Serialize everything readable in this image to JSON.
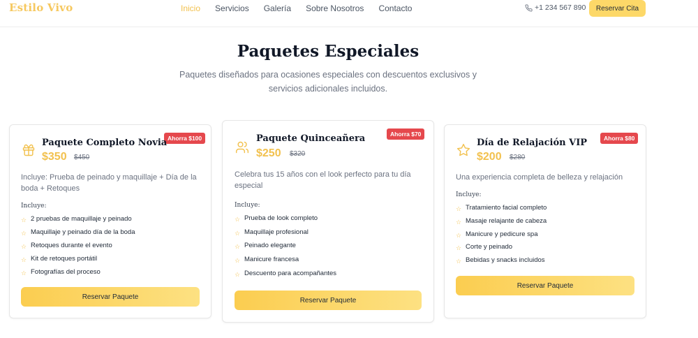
{
  "brand": {
    "logo": "Estilo Vivo",
    "accent_color": "#f2c14e"
  },
  "nav": {
    "links": [
      "Inicio",
      "Servicios",
      "Galería",
      "Sobre Nosotros",
      "Contacto"
    ],
    "active": "Inicio",
    "phone_icon": "phone-icon",
    "phone": "+1 234 567 890",
    "cta": "Reservar Cita"
  },
  "section": {
    "title": "Paquetes Especiales",
    "subtitle": "Paquetes diseñados para ocasiones especiales con descuentos exclusivos y servicios adicionales incluidos."
  },
  "packages": [
    {
      "icon": "gift-icon",
      "badge": "Ahorra $100",
      "title": "Paquete Completo Novia",
      "price": "$350",
      "old_price": "$450",
      "description": "Incluye: Prueba de peinado y maquillaje + Día de la boda + Retoques",
      "includes_label": "Incluye:",
      "features": [
        "2 pruebas de maquillaje y peinado",
        "Maquillaje y peinado día de la boda",
        "Retoques durante el evento",
        "Kit de retoques portátil",
        "Fotografías del proceso"
      ],
      "button": "Reservar Paquete"
    },
    {
      "icon": "users-icon",
      "badge": "Ahorra $70",
      "title": "Paquete Quinceañera",
      "price": "$250",
      "old_price": "$320",
      "description": "Celebra tus 15 años con el look perfecto para tu día especial",
      "includes_label": "Incluye:",
      "features": [
        "Prueba de look completo",
        "Maquillaje profesional",
        "Peinado elegante",
        "Manicure francesa",
        "Descuento para acompañantes"
      ],
      "button": "Reservar Paquete"
    },
    {
      "icon": "star-outline-icon",
      "badge": "Ahorra $80",
      "title": "Día de Relajación VIP",
      "price": "$200",
      "old_price": "$280",
      "description": "Una experiencia completa de belleza y relajación",
      "includes_label": "Incluye:",
      "features": [
        "Tratamiento facial completo",
        "Masaje relajante de cabeza",
        "Manicure y pedicure spa",
        "Corte y peinado",
        "Bebidas y snacks incluidos"
      ],
      "button": "Reservar Paquete"
    }
  ]
}
